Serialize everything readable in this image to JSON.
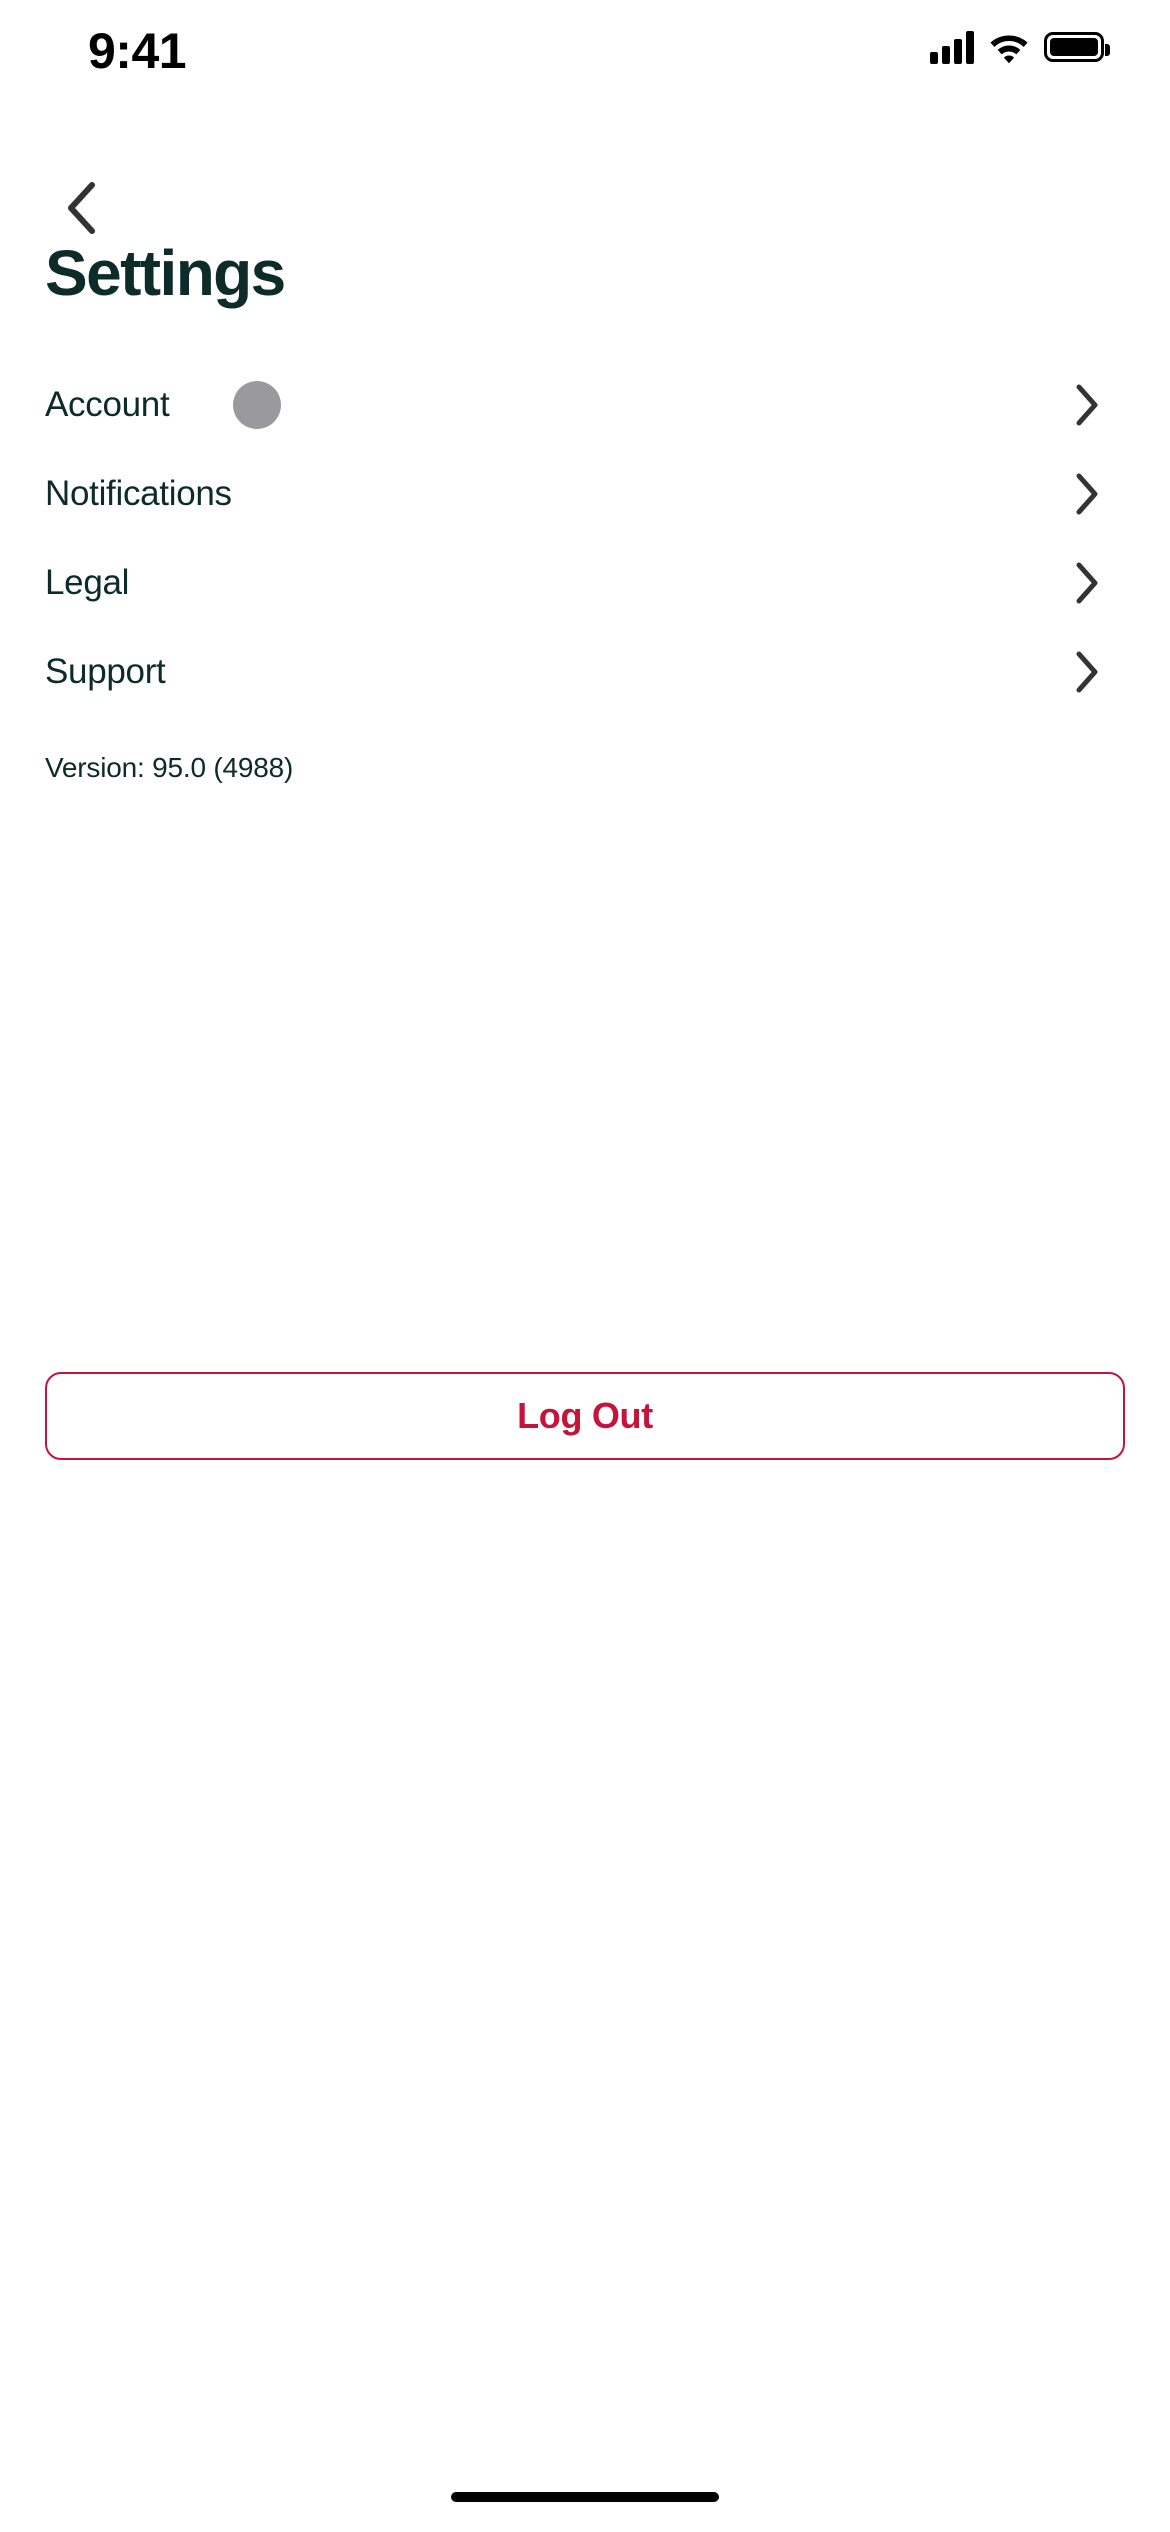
{
  "status_bar": {
    "time": "9:41",
    "cellular_icon": "signal-bars-icon",
    "wifi_icon": "wifi-icon",
    "battery_icon": "battery-full-icon",
    "battery_level_percent": 100
  },
  "nav": {
    "back_icon": "chevron-left-icon",
    "back_label": ""
  },
  "header": {
    "title": "Settings",
    "title_color": "#0d2b28"
  },
  "settings_list": {
    "items": [
      {
        "label": "Account",
        "has_avatar": true,
        "avatar_color": "#9a9a9e",
        "chevron": "chevron-right-icon"
      },
      {
        "label": "Notifications",
        "has_avatar": false,
        "chevron": "chevron-right-icon"
      },
      {
        "label": "Legal",
        "has_avatar": false,
        "chevron": "chevron-right-icon"
      },
      {
        "label": "Support",
        "has_avatar": false,
        "chevron": "chevron-right-icon"
      }
    ]
  },
  "version": {
    "text": "Version: 95.0 (4988)"
  },
  "logout": {
    "label": "Log Out",
    "accent_color": "#c4143c"
  },
  "system": {
    "home_indicator": "home-indicator-bar"
  }
}
